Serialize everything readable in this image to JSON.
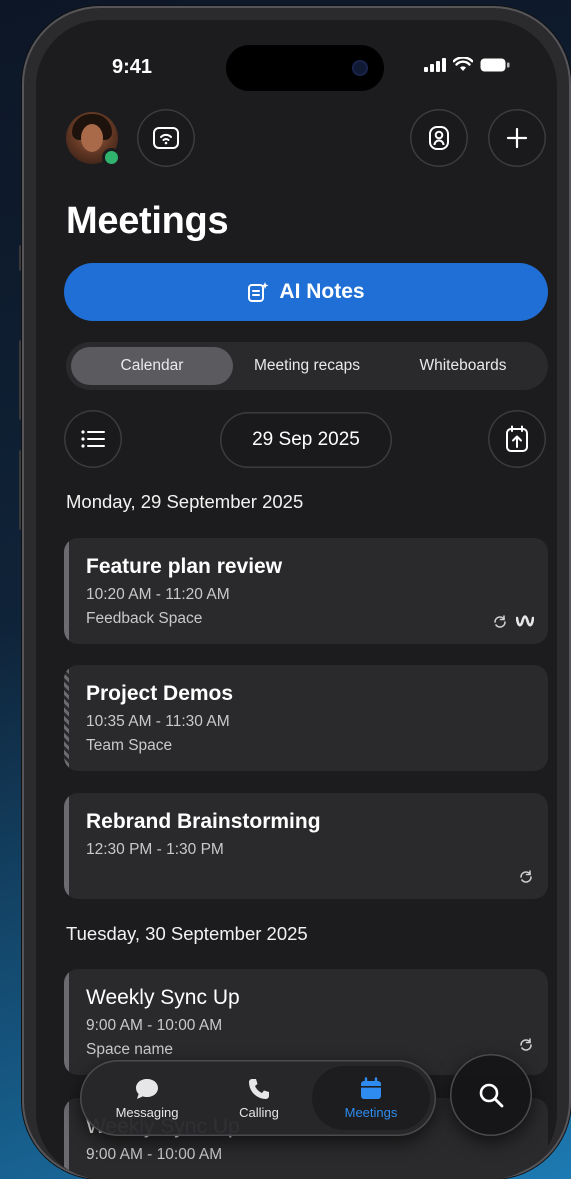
{
  "status": {
    "time": "9:41"
  },
  "header": {
    "title": "Meetings"
  },
  "ai_notes": {
    "label": "AI Notes"
  },
  "segments": [
    {
      "label": "Calendar",
      "active": true
    },
    {
      "label": "Meeting recaps",
      "active": false
    },
    {
      "label": "Whiteboards",
      "active": false
    }
  ],
  "date_picker": {
    "label": "29 Sep 2025"
  },
  "days": [
    {
      "heading": "Monday, 29 September 2025"
    },
    {
      "heading": "Tuesday, 30 September 2025"
    }
  ],
  "meetings": [
    {
      "title": "Feature plan review",
      "time": "10:20 AM - 11:20 AM",
      "space": "Feedback Space",
      "icons": [
        "recurring-icon",
        "webex-icon"
      ]
    },
    {
      "title": "Project Demos",
      "time": "10:35 AM - 11:30 AM",
      "space": "Team Space",
      "icons": []
    },
    {
      "title": "Rebrand Brainstorming",
      "time": "12:30 PM - 1:30 PM",
      "space": "",
      "icons": [
        "recurring-icon"
      ]
    },
    {
      "title": "Weekly Sync Up",
      "time": "9:00 AM - 10:00 AM",
      "space": "Space name",
      "icons": [
        "recurring-icon"
      ]
    },
    {
      "title": "Weekly Sync Up",
      "time": "9:00 AM - 10:00 AM",
      "space": "",
      "icons": []
    }
  ],
  "tabbar": {
    "items": [
      {
        "label": "Messaging",
        "icon": "chat-bubble-icon",
        "active": false
      },
      {
        "label": "Calling",
        "icon": "phone-icon",
        "active": false
      },
      {
        "label": "Meetings",
        "icon": "calendar-icon",
        "active": true
      }
    ]
  },
  "colors": {
    "accent": "#1f6fd6",
    "active_tab": "#2e8cf0",
    "presence": "#2fb36f",
    "background": "#1c1c1e"
  }
}
